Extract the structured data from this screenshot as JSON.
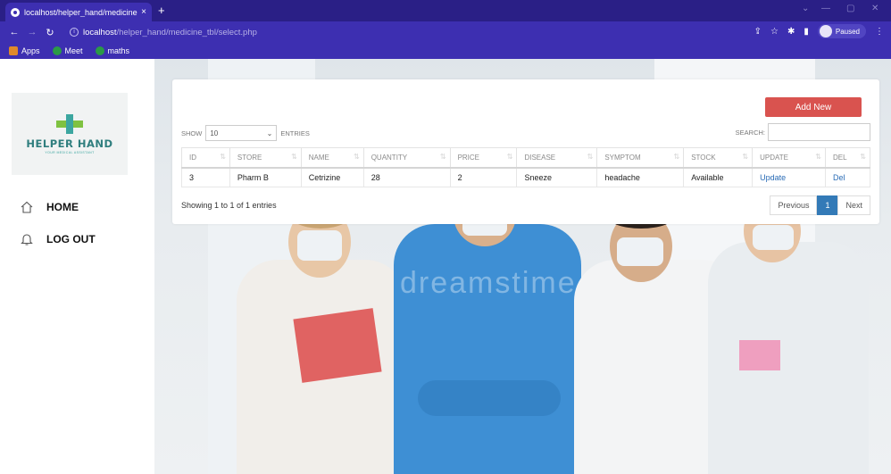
{
  "browser": {
    "tab_title": "localhost/helper_hand/medicine",
    "tab_close": "×",
    "new_tab": "+",
    "url_host": "localhost",
    "url_path": "/helper_hand/medicine_tbl/select.php",
    "profile_status": "Paused",
    "bookmarks": [
      {
        "label": "Apps",
        "color": "#e0892a"
      },
      {
        "label": "Meet",
        "color": "#2b9a47"
      },
      {
        "label": "maths",
        "color": "#2b9a47"
      }
    ]
  },
  "sidebar": {
    "logo_text": "HELPER HAND",
    "logo_subtext": "YOUR MEDICAL ASSISTANT",
    "menu": [
      {
        "label": "HOME",
        "icon": "home-icon"
      },
      {
        "label": "LOG OUT",
        "icon": "bell-icon"
      }
    ]
  },
  "table_card": {
    "add_button": "Add New",
    "show_label": "SHOW",
    "entries_label": "ENTRIES",
    "page_size": "10",
    "search_label": "SEARCH:",
    "search_value": "",
    "columns": [
      "ID",
      "STORE",
      "NAME",
      "QUANTITY",
      "PRICE",
      "DISEASE",
      "SYMPTOM",
      "STOCK",
      "UPDATE",
      "DEL"
    ],
    "rows": [
      [
        "3",
        "Pharm B",
        "Cetrizine",
        "28",
        "2",
        "Sneeze",
        "headache",
        "Available",
        "Update",
        "Del"
      ]
    ],
    "info": "Showing 1 to 1 of 1 entries",
    "pagination": {
      "previous": "Previous",
      "current": "1",
      "next": "Next"
    }
  },
  "colors": {
    "browser_frame": "#3d2fb1",
    "add_button": "#d9534f",
    "link": "#2a6cb6",
    "page_active": "#337ab7"
  }
}
